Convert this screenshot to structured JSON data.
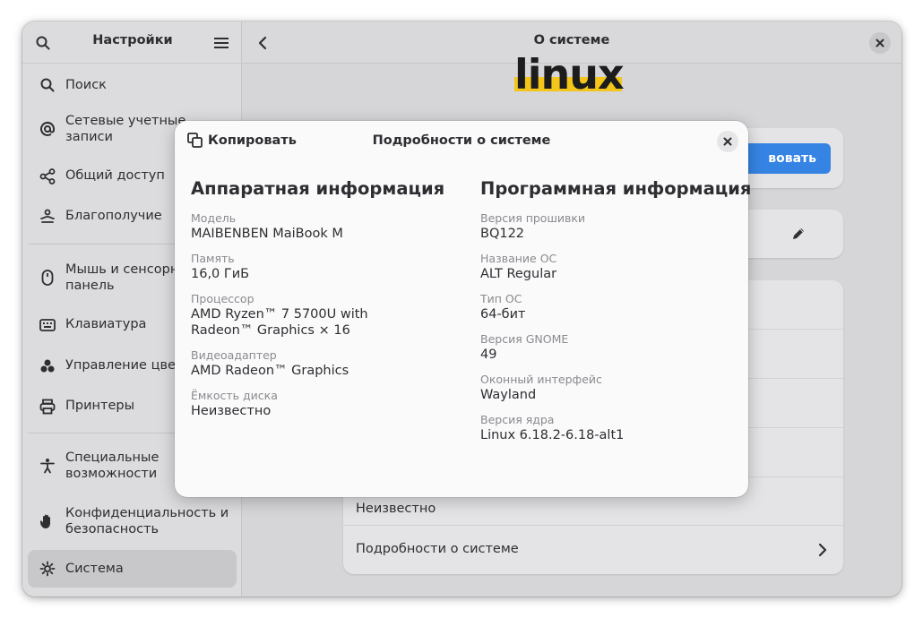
{
  "sidebar": {
    "title": "Настройки",
    "items": [
      {
        "label": "Поиск",
        "icon": "search-icon"
      },
      {
        "label": "Сетевые учетные\nзаписи",
        "icon": "at-sign-icon"
      },
      {
        "label": "Общий доступ",
        "icon": "share-icon"
      },
      {
        "label": "Благополучие",
        "icon": "wellbeing-icon"
      },
      {
        "label": "Мышь и сенсорная\nпанель",
        "icon": "mouse-icon"
      },
      {
        "label": "Клавиатура",
        "icon": "keyboard-icon"
      },
      {
        "label": "Управление цветом",
        "icon": "color-icon"
      },
      {
        "label": "Принтеры",
        "icon": "printer-icon"
      },
      {
        "label": "Специальные\nвозможности",
        "icon": "accessibility-icon"
      },
      {
        "label": "Конфиденциальность и\nбезопасность",
        "icon": "privacy-hand-icon"
      },
      {
        "label": "Система",
        "icon": "gear-icon"
      }
    ]
  },
  "main": {
    "title": "О системе",
    "logo_text": "linux",
    "button_label": "вовать",
    "rows": [
      "Неизвестно",
      "Подробности о системе"
    ]
  },
  "dialog": {
    "copy_label": "Копировать",
    "title": "Подробности о системе",
    "hardware": {
      "heading": "Аппаратная информация",
      "fields": [
        {
          "label": "Модель",
          "value": "MAIBENBEN MaiBook M"
        },
        {
          "label": "Память",
          "value": "16,0 ГиБ"
        },
        {
          "label": "Процессор",
          "value": "AMD Ryzen™ 7 5700U with\nRadeon™ Graphics × 16"
        },
        {
          "label": "Видеоадаптер",
          "value": "AMD Radeon™ Graphics"
        },
        {
          "label": "Ёмкость диска",
          "value": "Неизвестно"
        }
      ]
    },
    "software": {
      "heading": "Программная информация",
      "fields": [
        {
          "label": "Версия прошивки",
          "value": "BQ122"
        },
        {
          "label": "Название ОС",
          "value": "ALT Regular"
        },
        {
          "label": "Тип ОС",
          "value": "64-бит"
        },
        {
          "label": "Версия GNOME",
          "value": "49"
        },
        {
          "label": "Оконный интерфейс",
          "value": "Wayland"
        },
        {
          "label": "Версия ядра",
          "value": "Linux 6.18.2-6.18-alt1"
        }
      ]
    }
  },
  "colors": {
    "accent": "#3584e4",
    "logo_yellow": "#f4c51a"
  }
}
